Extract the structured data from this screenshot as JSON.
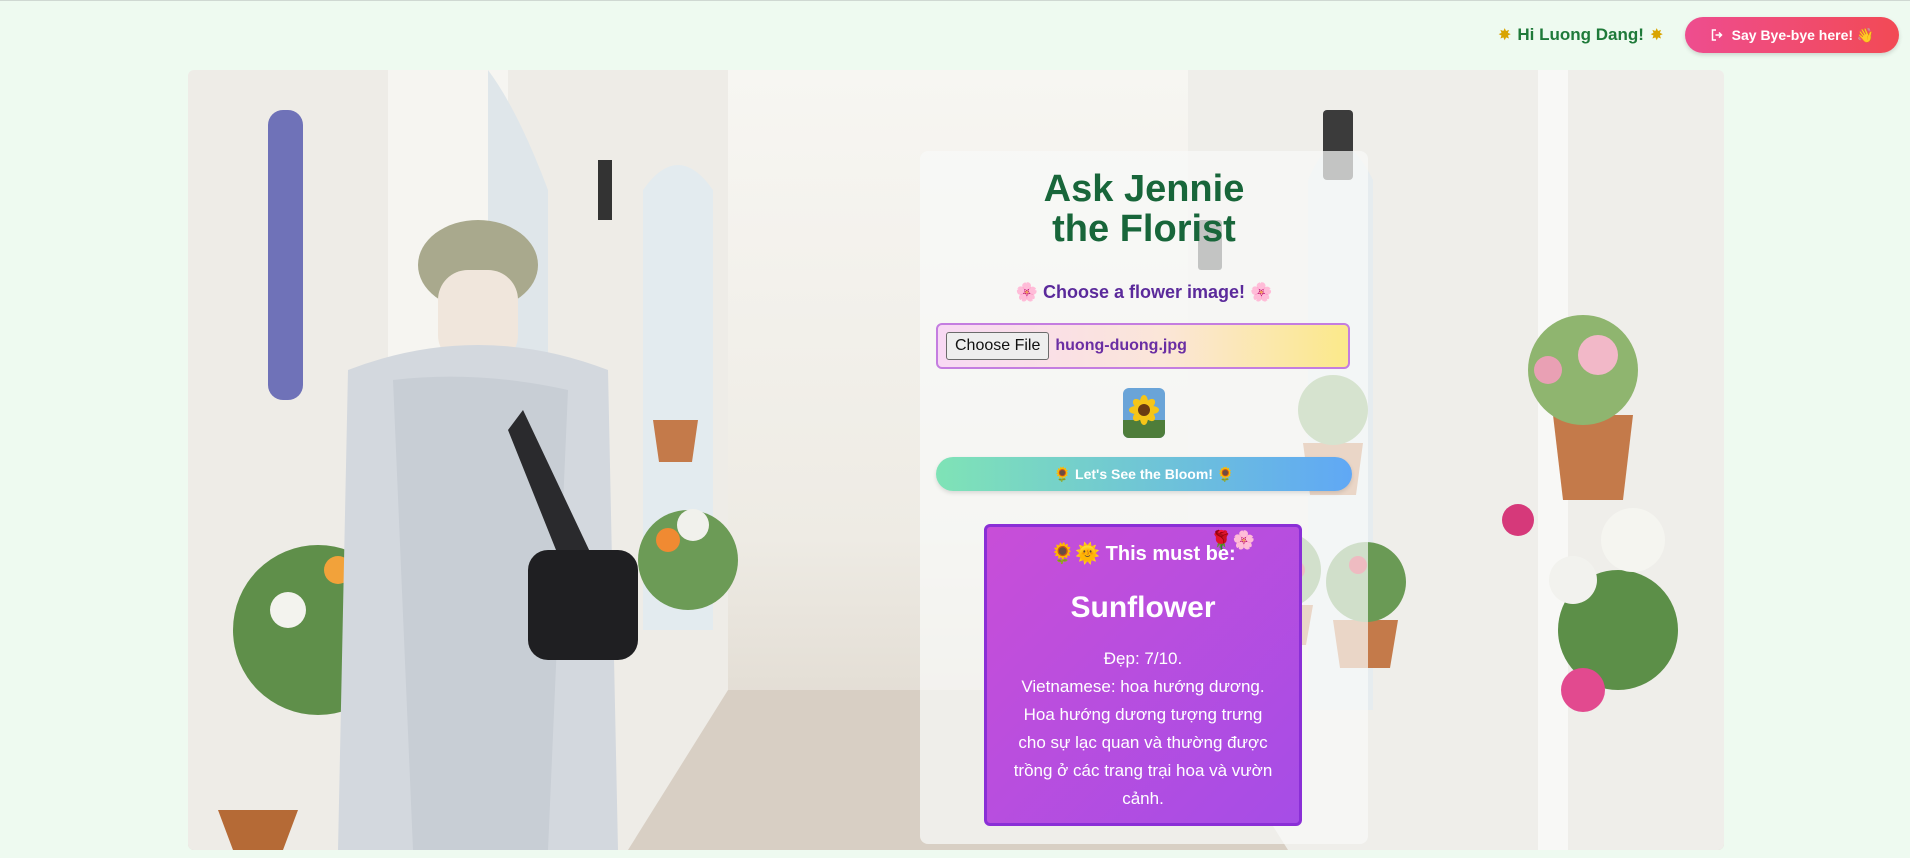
{
  "header": {
    "greeting_left_icon": "sparkle-icon",
    "greeting": "Hi Luong Dang!",
    "greeting_right_icon": "sparkle-icon",
    "logout_icon": "logout-icon",
    "logout_label": "Say Bye-bye here! 👋"
  },
  "card": {
    "title_line1": "Ask Jennie",
    "title_line2": "the Florist",
    "choose_label": "🌸 Choose a flower image! 🌸",
    "file_button": "Choose File",
    "file_name": "huong-duong.jpg",
    "thumbnail_icon": "sunflower-thumbnail",
    "bloom_button": "🌻 Let's See the Bloom! 🌻"
  },
  "result": {
    "header": "🌻🌞 This must be:",
    "header_flowers": "🌹🌸",
    "flower_name": "Sunflower",
    "score": "Đẹp: 7/10.",
    "description": "Vietnamese: hoa hướng dương.\nHoa hướng dương tượng trưng\ncho sự lạc quan và thường được\ntrồng ở các trang trại hoa và vườn\ncảnh."
  },
  "colors": {
    "background": "#eefaf0",
    "title": "#18663a",
    "accent_purple": "#a64de6",
    "logout_start": "#ee4d8f",
    "logout_end": "#f24a55",
    "bloom_start": "#7fe3b6",
    "bloom_end": "#60a8f5"
  }
}
